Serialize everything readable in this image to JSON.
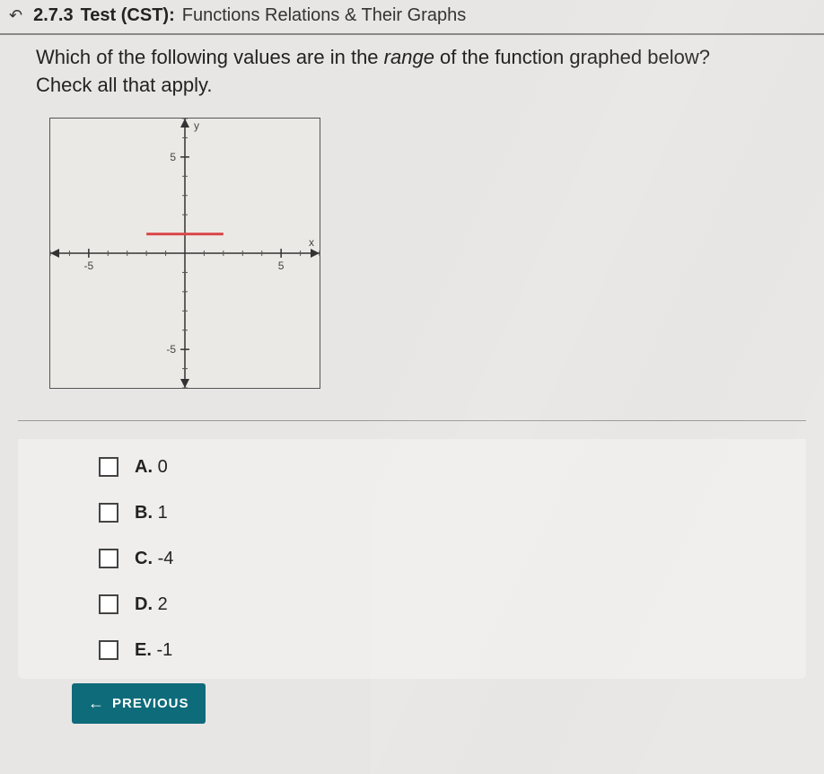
{
  "header": {
    "number": "2.7.3",
    "label": "Test (CST):",
    "title": "Functions Relations & Their Graphs"
  },
  "question": {
    "line1_a": "Which of the following values are in the ",
    "line1_range": "range",
    "line1_b": " of the function graphed below?",
    "line2": "Check all that apply."
  },
  "chart_data": {
    "type": "line",
    "xlabel": "x",
    "ylabel": "y",
    "xlim": [
      -7,
      7
    ],
    "ylim": [
      -7,
      7
    ],
    "x_ticks": [
      -5,
      5
    ],
    "y_ticks": [
      -5,
      5
    ],
    "series": [
      {
        "name": "segment",
        "color": "#d9484a",
        "points": [
          [
            -2,
            1
          ],
          [
            2,
            1
          ]
        ]
      }
    ]
  },
  "answers": [
    {
      "letter": "A.",
      "text": "0"
    },
    {
      "letter": "B.",
      "text": "1"
    },
    {
      "letter": "C.",
      "text": "-4"
    },
    {
      "letter": "D.",
      "text": "2"
    },
    {
      "letter": "E.",
      "text": "-1"
    }
  ],
  "nav": {
    "previous": "PREVIOUS"
  }
}
